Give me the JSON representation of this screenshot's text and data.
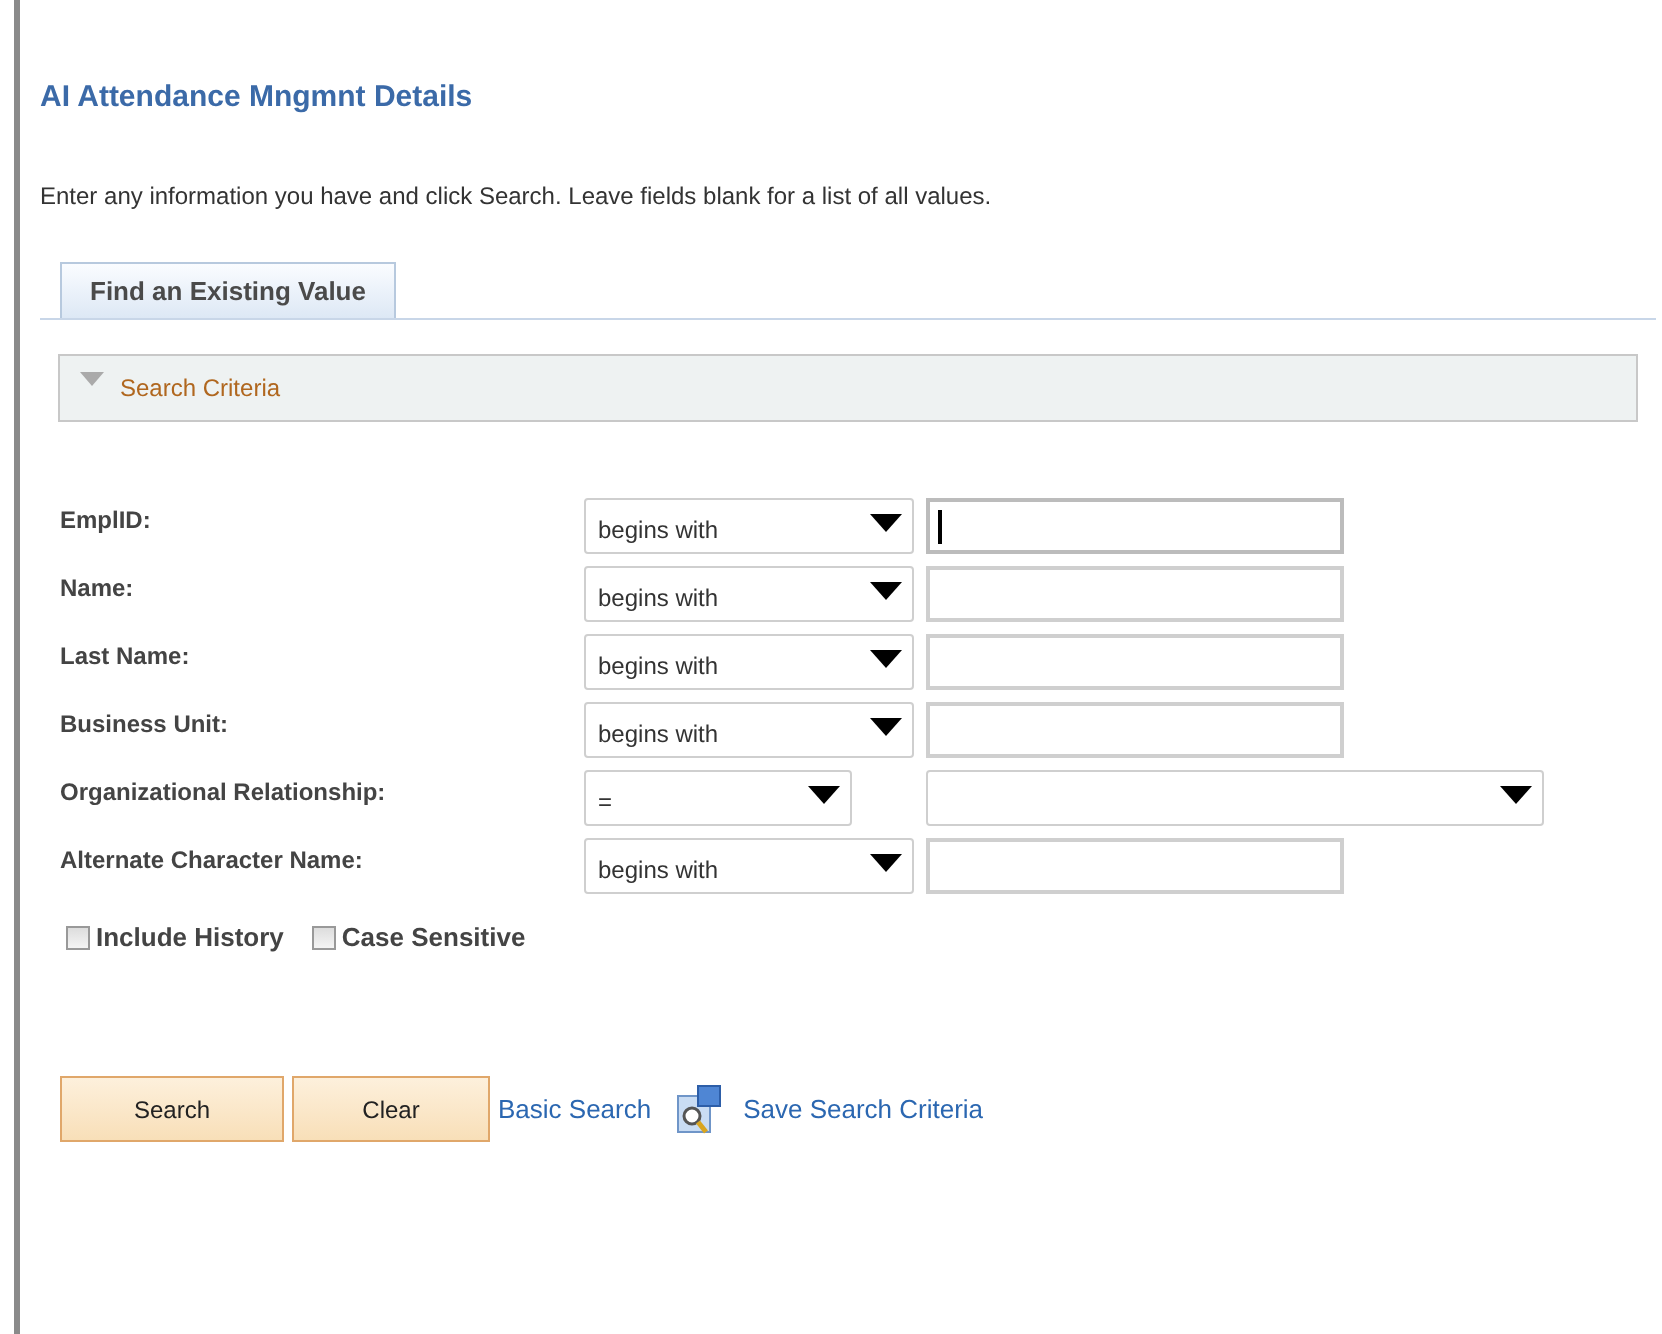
{
  "page": {
    "title": "AI Attendance Mngmnt Details",
    "instructions": "Enter any information you have and click Search. Leave fields blank for a list of all values."
  },
  "tabs": [
    {
      "label": "Find an Existing Value",
      "selected": true
    }
  ],
  "section": {
    "label": "Search Criteria",
    "expanded": true
  },
  "fields": [
    {
      "kind": "text",
      "label": "EmplID:",
      "operator": "begins with",
      "focused": true
    },
    {
      "kind": "text",
      "label": "Name:",
      "operator": "begins with",
      "focused": false
    },
    {
      "kind": "text",
      "label": "Last Name:",
      "operator": "begins with",
      "focused": false
    },
    {
      "kind": "text",
      "label": "Business Unit:",
      "operator": "begins with",
      "focused": false
    },
    {
      "kind": "select",
      "label": "Organizational Relationship:",
      "operator": "="
    },
    {
      "kind": "text",
      "label": "Alternate Character Name:",
      "operator": "begins with",
      "focused": false
    }
  ],
  "options": [
    {
      "label": "Include History",
      "checked": false
    },
    {
      "label": "Case Sensitive",
      "checked": false
    }
  ],
  "buttons": [
    "Search",
    "Clear"
  ],
  "links": [
    {
      "label": "Basic Search",
      "kind": "plain"
    },
    {
      "label": "Save Search Criteria",
      "kind": "save"
    }
  ]
}
